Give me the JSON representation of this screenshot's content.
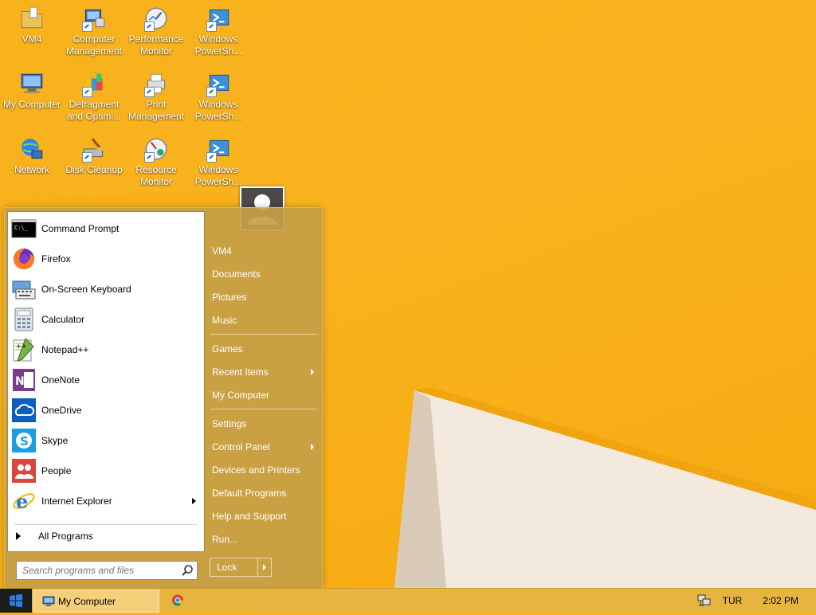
{
  "desktop": {
    "icons": [
      {
        "label": "VM4",
        "icon": "folder-icon"
      },
      {
        "label": "Computer Management",
        "icon": "computer-management-icon"
      },
      {
        "label": "Performance Monitor",
        "icon": "performance-monitor-icon"
      },
      {
        "label": "Windows PowerSh...",
        "icon": "powershell-icon"
      },
      {
        "label": "My Computer",
        "icon": "my-computer-icon"
      },
      {
        "label": "Defragment and Optimi...",
        "icon": "defragment-icon"
      },
      {
        "label": "Print Management",
        "icon": "print-management-icon"
      },
      {
        "label": "Windows PowerSh...",
        "icon": "powershell-icon"
      },
      {
        "label": "Network",
        "icon": "network-icon"
      },
      {
        "label": "Disk Cleanup",
        "icon": "disk-cleanup-icon"
      },
      {
        "label": "Resource Monitor",
        "icon": "resource-monitor-icon"
      },
      {
        "label": "Windows PowerSh...",
        "icon": "powershell-icon"
      }
    ]
  },
  "start_menu": {
    "programs": [
      {
        "label": "Command Prompt",
        "icon": "command-prompt-icon",
        "has_submenu": false
      },
      {
        "label": "Firefox",
        "icon": "firefox-icon",
        "has_submenu": false
      },
      {
        "label": "On-Screen Keyboard",
        "icon": "keyboard-icon",
        "has_submenu": false
      },
      {
        "label": "Calculator",
        "icon": "calculator-icon",
        "has_submenu": false
      },
      {
        "label": "Notepad++",
        "icon": "notepad-plus-plus-icon",
        "has_submenu": false
      },
      {
        "label": "OneNote",
        "icon": "onenote-icon",
        "has_submenu": false
      },
      {
        "label": "OneDrive",
        "icon": "onedrive-icon",
        "has_submenu": false
      },
      {
        "label": "Skype",
        "icon": "skype-icon",
        "has_submenu": false
      },
      {
        "label": "People",
        "icon": "people-icon",
        "has_submenu": false
      },
      {
        "label": "Internet Explorer",
        "icon": "internet-explorer-icon",
        "has_submenu": true
      }
    ],
    "all_programs_label": "All Programs",
    "search": {
      "placeholder": "Search programs and files"
    },
    "right_items": [
      {
        "label": "VM4",
        "has_submenu": false
      },
      {
        "label": "Documents",
        "has_submenu": false
      },
      {
        "label": "Pictures",
        "has_submenu": false
      },
      {
        "label": "Music",
        "has_submenu": false
      },
      {
        "label": "Games",
        "has_submenu": false
      },
      {
        "label": "Recent Items",
        "has_submenu": true
      },
      {
        "label": "My Computer",
        "has_submenu": false
      },
      {
        "label": "Settings",
        "has_submenu": false
      },
      {
        "label": "Control Panel",
        "has_submenu": true
      },
      {
        "label": "Devices and Printers",
        "has_submenu": false
      },
      {
        "label": "Default Programs",
        "has_submenu": false
      },
      {
        "label": "Help and Support",
        "has_submenu": false
      },
      {
        "label": "Run...",
        "has_submenu": false
      }
    ],
    "lock_label": "Lock"
  },
  "taskbar": {
    "window_button_label": "My Computer",
    "language": "TUR",
    "clock": "2:02 PM"
  },
  "colors": {
    "wallpaper": "#f8b21c",
    "start_menu_bg": "#c4a046",
    "taskbar": "#e8b440"
  }
}
